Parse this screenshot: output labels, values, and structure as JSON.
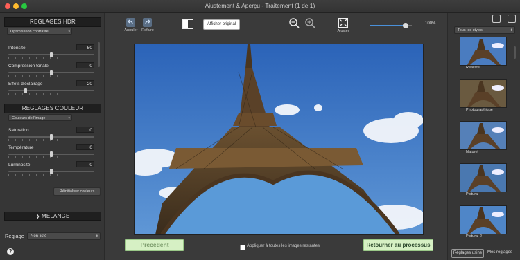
{
  "window": {
    "title": "Ajustement & Aperçu - Traitement (1 de 1)"
  },
  "left": {
    "hdr_header": "REGLAGES HDR",
    "hdr_preset": "Optimisation contraste",
    "hdr_sliders": [
      {
        "label": "Intensité",
        "value": "50",
        "level": 0.5
      },
      {
        "label": "Compression tonale",
        "value": "0",
        "level": 0.5
      },
      {
        "label": "Effets d'éclairage",
        "value": "20",
        "level": 0.2
      }
    ],
    "color_header": "REGLAGES COULEUR",
    "color_preset": "Couleurs de l'image",
    "color_sliders": [
      {
        "label": "Saturation",
        "value": "0",
        "level": 0.5
      },
      {
        "label": "Température",
        "value": "0",
        "level": 0.5
      },
      {
        "label": "Luminosité",
        "value": "0",
        "level": 0.5
      }
    ],
    "reset_colors": "Réinitialiser couleurs",
    "melange": "MELANGE",
    "reglage_label": "Réglage",
    "reglage_value": "Non listé",
    "help": "?"
  },
  "toolbar": {
    "undo": "Annuler",
    "redo": "Refaire",
    "show_original": "Afficher original",
    "fit": "Ajuster",
    "zoom": "100%",
    "zoom_level": 0.85
  },
  "bottom": {
    "previous": "Précédent",
    "apply_all": "Appliquer à toutes les images restantes",
    "return": "Retourner au processus"
  },
  "right": {
    "filter": "Tous les styles",
    "styles": [
      "Réaliste",
      "Photographique",
      "Naturel",
      "Pictural",
      "Pictural 2"
    ],
    "tab_factory": "Réglages usine",
    "tab_mine": "Mes réglages"
  },
  "colors": {
    "accent": "#4a90d9",
    "green_button": "#d6f0c4"
  }
}
